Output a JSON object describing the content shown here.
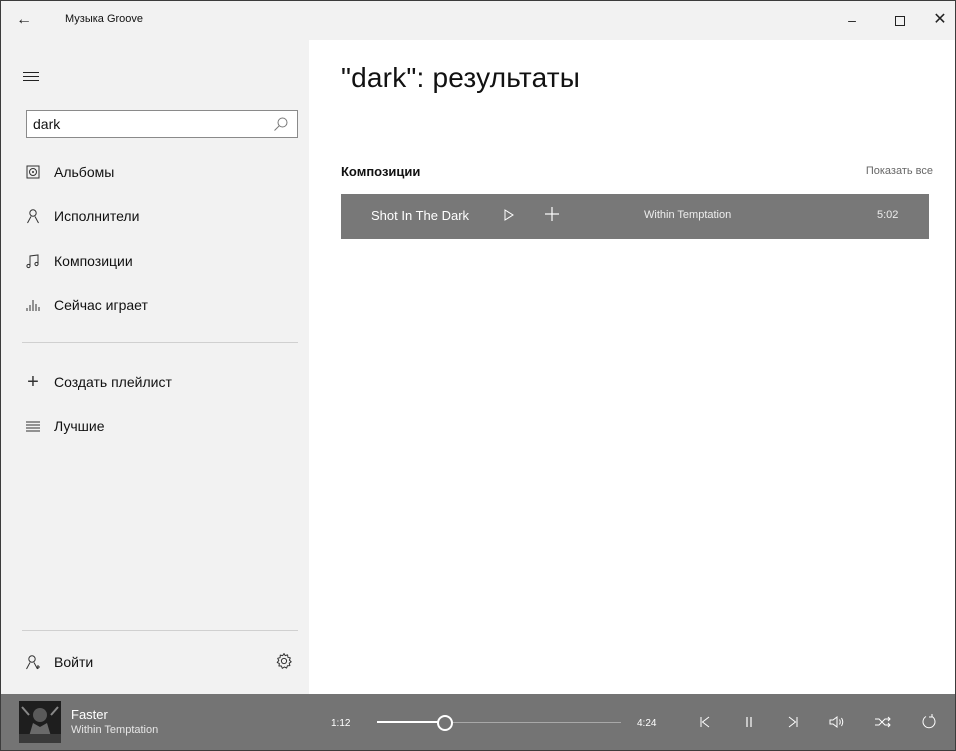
{
  "window": {
    "title": "Музыка Groove",
    "back_icon": "←",
    "minimize_glyph": "–",
    "close_glyph": "✕"
  },
  "sidebar": {
    "search": {
      "value": "dark",
      "placeholder": ""
    },
    "nav": [
      {
        "label": "Альбомы",
        "icon": "album-icon"
      },
      {
        "label": "Исполнители",
        "icon": "artist-icon"
      },
      {
        "label": "Композиции",
        "icon": "music-note-icon"
      },
      {
        "label": "Сейчас играет",
        "icon": "now-playing-icon"
      }
    ],
    "create_playlist": {
      "label": "Создать плейлист",
      "glyph": "+"
    },
    "playlists": [
      {
        "label": "Лучшие",
        "icon": "playlist-icon"
      }
    ],
    "sign_in": {
      "label": "Войти"
    }
  },
  "main": {
    "title": "\"dark\": результаты",
    "section": {
      "title": "Композиции",
      "show_all": "Показать все"
    },
    "tracks": [
      {
        "title": "Shot In The Dark",
        "artist": "Within Temptation",
        "duration": "5:02"
      }
    ]
  },
  "player": {
    "now_playing": {
      "title": "Faster",
      "artist": "Within Temptation"
    },
    "current_time": "1:12",
    "total_time": "4:24",
    "progress": 0.28
  },
  "colors": {
    "sidebar_bg": "#f2f2f2",
    "selected_row_bg": "#787878",
    "player_bg": "#747474"
  }
}
